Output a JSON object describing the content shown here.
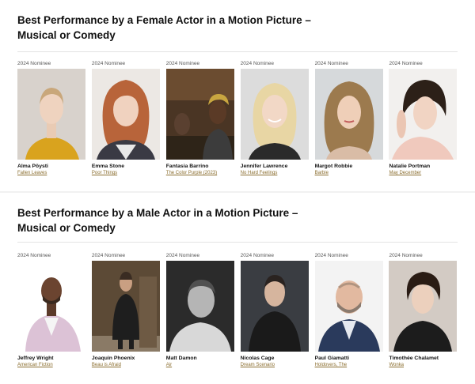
{
  "sections": [
    {
      "title": "Best Performance by a Female Actor in a Motion Picture – Musical or Comedy",
      "nominees": [
        {
          "tag": "2024 Nominee",
          "name": "Alma Pöysti",
          "film": "Fallen Leaves"
        },
        {
          "tag": "2024 Nominee",
          "name": "Emma Stone",
          "film": "Poor Things"
        },
        {
          "tag": "2024 Nominee",
          "name": "Fantasia Barrino",
          "film": "The Color Purple (2023)"
        },
        {
          "tag": "2024 Nominee",
          "name": "Jennifer Lawrence",
          "film": "No Hard Feelings"
        },
        {
          "tag": "2024 Nominee",
          "name": "Margot Robbie",
          "film": "Barbie"
        },
        {
          "tag": "2024 Nominee",
          "name": "Natalie Portman",
          "film": "May December"
        }
      ]
    },
    {
      "title": "Best Performance by a Male Actor in a Motion Picture – Musical or Comedy",
      "nominees": [
        {
          "tag": "2024 Nominee",
          "name": "Jeffrey Wright",
          "film": "American Fiction"
        },
        {
          "tag": "2024 Nominee",
          "name": "Joaquin Phoenix",
          "film": "Beau is Afraid"
        },
        {
          "tag": "2024 Nominee",
          "name": "Matt Damon",
          "film": "Air"
        },
        {
          "tag": "2024 Nominee",
          "name": "Nicolas Cage",
          "film": "Dream Scenario"
        },
        {
          "tag": "2024 Nominee",
          "name": "Paul Giamatti",
          "film": "Holdovers, The"
        },
        {
          "tag": "2024 Nominee",
          "name": "Timothée Chalamet",
          "film": "Wonka"
        }
      ]
    }
  ],
  "colors": {
    "film_link": "#8a6d2e",
    "divider": "#e3e3e3"
  }
}
